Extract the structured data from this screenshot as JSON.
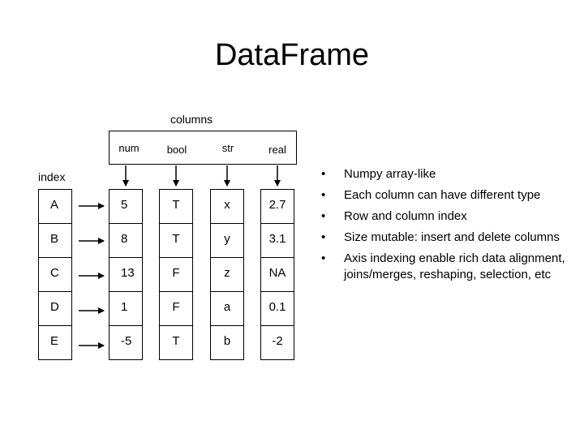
{
  "title": "DataFrame",
  "columns_label": "columns",
  "index_label": "index",
  "column_names": [
    "num",
    "bool",
    "str",
    "real"
  ],
  "index_values": [
    "A",
    "B",
    "C",
    "D",
    "E"
  ],
  "columns": {
    "num": [
      "5",
      "8",
      "13",
      "1",
      "-5"
    ],
    "bool": [
      "T",
      "T",
      "F",
      "F",
      "T"
    ],
    "str": [
      "x",
      "y",
      "z",
      "a",
      "b"
    ],
    "real": [
      "2.7",
      "3.1",
      "NA",
      "0.1",
      "-2"
    ]
  },
  "bullet_symbol": "•",
  "bullets": [
    "Numpy array-like",
    "Each column can have different type",
    "Row and column index",
    "Size mutable: insert and delete columns",
    "Axis indexing enable rich data alignment, joins/merges, reshaping, selection, etc"
  ]
}
